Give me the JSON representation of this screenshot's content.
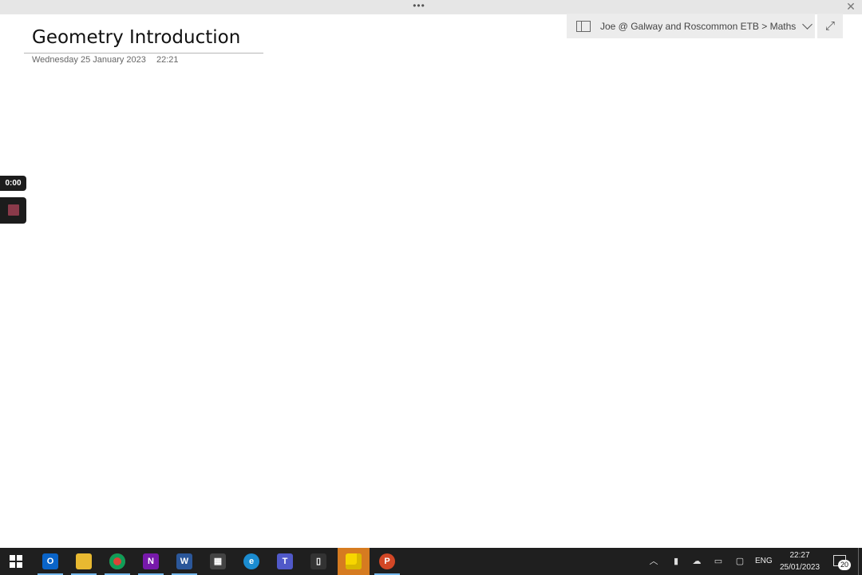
{
  "window": {
    "grip": "•••",
    "close": "✕"
  },
  "page": {
    "title": "Geometry Introduction",
    "date": "Wednesday 25 January 2023",
    "time": "22:21"
  },
  "notebook": {
    "path": "Joe @ Galway and Roscommon ETB > Maths",
    "expand_icon": "⤢"
  },
  "recorder": {
    "timer": "0:00"
  },
  "taskbar": {
    "apps": [
      {
        "name": "outlook",
        "letter": "O",
        "color": "#0a64c8"
      },
      {
        "name": "file-explorer",
        "letter": "",
        "color": "#e8b931"
      },
      {
        "name": "chrome",
        "letter": "",
        "color": "#db4437"
      },
      {
        "name": "onenote",
        "letter": "N",
        "color": "#7719aa"
      },
      {
        "name": "word",
        "letter": "W",
        "color": "#2b579a"
      },
      {
        "name": "calculator",
        "letter": "▦",
        "color": "#444444"
      },
      {
        "name": "edge",
        "letter": "e",
        "color": "#1b8cd0"
      },
      {
        "name": "teams",
        "letter": "T",
        "color": "#5059c9"
      },
      {
        "name": "phone",
        "letter": "▯",
        "color": "#333333"
      },
      {
        "name": "sticky-notes",
        "letter": "",
        "color": "#f7d600"
      },
      {
        "name": "powerpoint",
        "letter": "P",
        "color": "#d24726"
      }
    ],
    "tray": {
      "lang": "ENG",
      "time": "22:27",
      "date": "25/01/2023",
      "notification_count": "20"
    }
  }
}
